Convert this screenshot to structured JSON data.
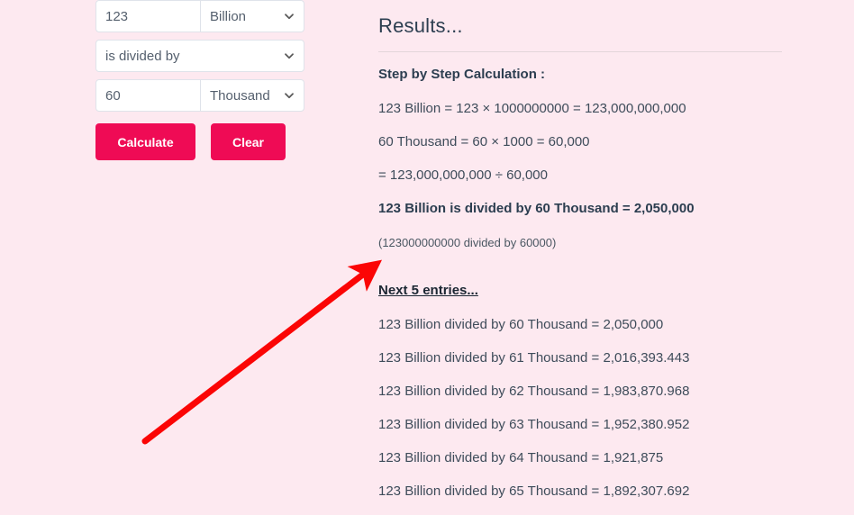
{
  "form": {
    "value1": {
      "number": "123",
      "unit": "Billion",
      "unit_icon": "chevron-down-icon"
    },
    "operation": {
      "label": "is divided by",
      "unit_icon": "chevron-down-icon"
    },
    "value2": {
      "number": "60",
      "unit": "Thousand",
      "unit_icon": "chevron-down-icon"
    },
    "calculate_label": "Calculate",
    "clear_label": "Clear",
    "button_color": "#ef0b55"
  },
  "results": {
    "title": "Results...",
    "step_heading": "Step by Step Calculation :",
    "steps": [
      "123 Billion = 123 × 1000000000 = 123,000,000,000",
      "60 Thousand = 60 × 1000 = 60,000",
      "= 123,000,000,000 ÷ 60,000"
    ],
    "answer": "123 Billion is divided by 60 Thousand = 2,050,000",
    "note": "(123000000000 divided by 60000)",
    "next_entries_label": "Next 5 entries...",
    "entries": [
      "123 Billion divided by 60 Thousand = 2,050,000",
      "123 Billion divided by 61 Thousand = 2,016,393.443",
      "123 Billion divided by 62 Thousand = 1,983,870.968",
      "123 Billion divided by 63 Thousand = 1,952,380.952",
      "123 Billion divided by 64 Thousand = 1,921,875",
      "123 Billion divided by 65 Thousand = 1,892,307.692"
    ]
  },
  "annotation": {
    "arrow_icon": "red-arrow-annotation",
    "color": "#fb0505"
  },
  "page": {
    "background_color": "#fde9f0",
    "text_color": "#3e4c5a"
  }
}
